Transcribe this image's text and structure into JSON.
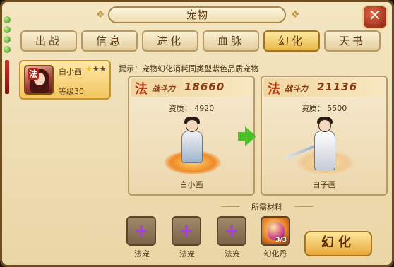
{
  "window": {
    "title": "宠物",
    "close_icon": "✕"
  },
  "tabs": [
    {
      "label": "出战",
      "active": false
    },
    {
      "label": "信息",
      "active": false
    },
    {
      "label": "进化",
      "active": false
    },
    {
      "label": "血脉",
      "active": false
    },
    {
      "label": "幻化",
      "active": true
    },
    {
      "label": "天书",
      "active": false
    }
  ],
  "selected_pet": {
    "class_badge": "法",
    "name": "白小画",
    "stars_filled": 1,
    "stars_total": 3,
    "level": "等级30"
  },
  "hint": "提示：宠物幻化消耗同类型紫色品质宠物",
  "current_pet": {
    "class_badge": "法",
    "power_label": "战斗力",
    "power_value": "18660",
    "aptitude": "资质： 4920",
    "name": "白小画"
  },
  "result_pet": {
    "class_badge": "法",
    "power_label": "战斗力",
    "power_value": "21136",
    "aptitude": "资质： 5500",
    "name": "白子画"
  },
  "materials": {
    "title": "所需材料",
    "slots": [
      {
        "label": "法宠",
        "kind": "empty"
      },
      {
        "label": "法宠",
        "kind": "empty"
      },
      {
        "label": "法宠",
        "kind": "empty"
      },
      {
        "label": "幻化丹",
        "kind": "item",
        "count": "3/3"
      }
    ]
  },
  "action_button": {
    "label": "幻化"
  },
  "colors": {
    "accent": "#e9a83a",
    "star": "#f7c21a",
    "plus": "#a63fd6",
    "arrow": "#4cbf2a"
  }
}
